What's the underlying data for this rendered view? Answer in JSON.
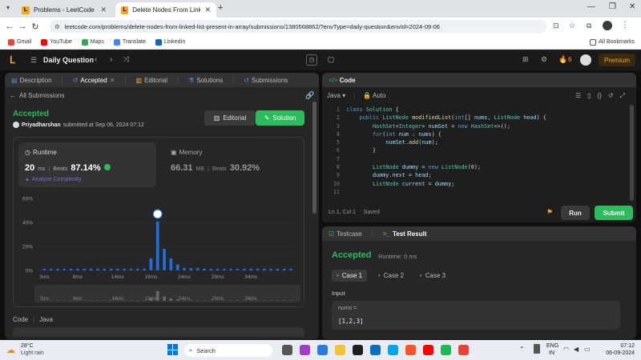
{
  "browser": {
    "tabs": [
      {
        "title": "Problems - LeetCode"
      },
      {
        "title": "Delete Nodes From Linked List"
      }
    ],
    "url": "leetcode.com/problems/delete-nodes-from-linked-list-present-in-array/submissions/1380568862/?envType=daily-question&envId=2024-09-06",
    "bookmarks": [
      "Gmail",
      "YouTube",
      "Maps",
      "Translate",
      "LinkedIn"
    ],
    "all_bookmarks": "All Bookmarks"
  },
  "lcnav": {
    "daily_question": "Daily Question",
    "streak": "6",
    "premium": "Premium"
  },
  "left": {
    "tabs": [
      "Description",
      "Accepted",
      "Editorial",
      "Solutions",
      "Submissions"
    ],
    "all_submissions": "All Submissions",
    "status": "Accepted",
    "user": "Priyadharshan",
    "submitted_text": "submitted at Sep 06, 2024 07:12",
    "editorial_btn": "Editorial",
    "solution_btn": "Solution",
    "runtime_label": "Runtime",
    "runtime_value": "20",
    "runtime_unit": "ms",
    "beats_label": "Beats",
    "runtime_beats": "87.14%",
    "analyze": "Analyze Complexity",
    "memory_label": "Memory",
    "memory_value": "66.31",
    "memory_unit": "MB",
    "memory_beats": "30.92%",
    "code_label": "Code",
    "lang_label": "Java"
  },
  "chart_data": {
    "type": "bar",
    "title": "",
    "xlabel": "",
    "ylabel": "",
    "y_ticks": [
      "60%",
      "40%",
      "20%",
      "0%"
    ],
    "ylim": [
      0,
      60
    ],
    "x_ticks": [
      "3ms",
      "8ms",
      "14ms",
      "19ms",
      "24ms",
      "29ms",
      "34ms"
    ],
    "mini_ticks": [
      "3ms",
      "8ms",
      "14ms",
      "19ms",
      "24ms",
      "29ms",
      "34ms"
    ],
    "highlight_index": 17,
    "values": [
      1.5,
      1.5,
      1.5,
      1.5,
      1.5,
      1.5,
      1.5,
      1.5,
      1.5,
      1.5,
      1.5,
      1.5,
      1.5,
      1.5,
      1.5,
      1.5,
      10,
      41,
      18,
      10,
      5,
      2,
      2,
      2,
      1.5,
      1.5,
      1.5,
      1.5,
      1.5,
      1.5,
      1.5,
      1.5,
      1.5,
      1.5,
      1.5,
      1.5,
      1.5,
      1.5
    ],
    "color": "#1e6fd9"
  },
  "right": {
    "code_title": "Code",
    "lang": "Java",
    "auto": "Auto",
    "status_pos": "Ln 1, Col 1",
    "status_saved": "Saved",
    "run": "Run",
    "submit": "Submit",
    "code_lines": [
      "class Solution {",
      "    public ListNode modifiedList(int[] nums, ListNode head) {",
      "        HashSet<Integer> numSet = new HashSet<>();",
      "        for(int num : nums) {",
      "            numSet.add(num);",
      "        }",
      "",
      "        ListNode dummy = new ListNode(0);",
      "        dummy.next = head;",
      "        ListNode current = dummy;",
      ""
    ],
    "testcase_tab": "Testcase",
    "testresult_tab": "Test Result",
    "result_status": "Accepted",
    "result_runtime": "Runtime: 0 ms",
    "cases": [
      "Case 1",
      "Case 2",
      "Case 3"
    ],
    "input_label": "Input",
    "input_var": "nums =",
    "input_value": "[1,2,3]"
  },
  "taskbar": {
    "temp": "28°C",
    "weather": "Light rain",
    "search": "Search",
    "lang1": "ENG",
    "lang2": "IN",
    "time": "07:12",
    "date": "06-09-2024"
  }
}
